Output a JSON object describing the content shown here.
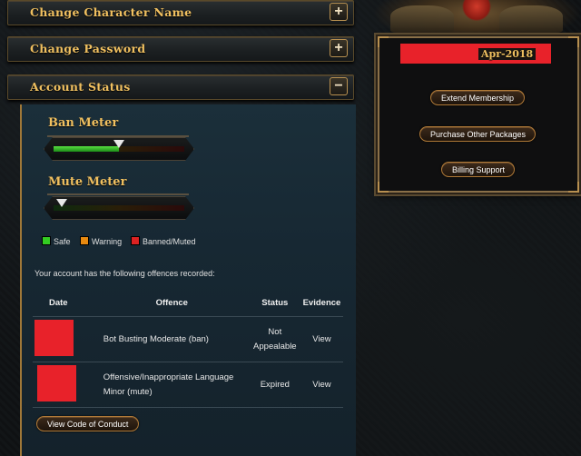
{
  "accordion": {
    "change_name": {
      "title": "Change Character Name",
      "toggle": "+"
    },
    "change_password": {
      "title": "Change Password",
      "toggle": "+"
    },
    "account_status": {
      "title": "Account Status",
      "toggle": "−"
    }
  },
  "meters": {
    "ban": {
      "title": "Ban Meter",
      "level": 0.5
    },
    "mute": {
      "title": "Mute Meter",
      "level": 0.06
    }
  },
  "legend": [
    {
      "label": "Safe",
      "color": "#33cc22"
    },
    {
      "label": "Warning",
      "color": "#e88a10"
    },
    {
      "label": "Banned/Muted",
      "color": "#dd2222"
    }
  ],
  "offences": {
    "intro": "Your account has the following offences recorded:",
    "headers": [
      "Date",
      "Offence",
      "Status",
      "Evidence"
    ],
    "rows": [
      {
        "offence": "Bot Busting Moderate (ban)",
        "status": "Not Appealable",
        "evidence": "View"
      },
      {
        "offence": "Offensive/Inappropriate Language Minor (mute)",
        "status": "Expired",
        "evidence": "View"
      }
    ],
    "code_button": "View Code of Conduct"
  },
  "membership": {
    "date": "Apr-2018",
    "buttons": [
      "Extend Membership",
      "Purchase Other Packages",
      "Billing Support"
    ]
  },
  "colors": {
    "accent_gold": "#f0c060",
    "link_gold": "#f0b030",
    "redaction": "#e8222a"
  }
}
